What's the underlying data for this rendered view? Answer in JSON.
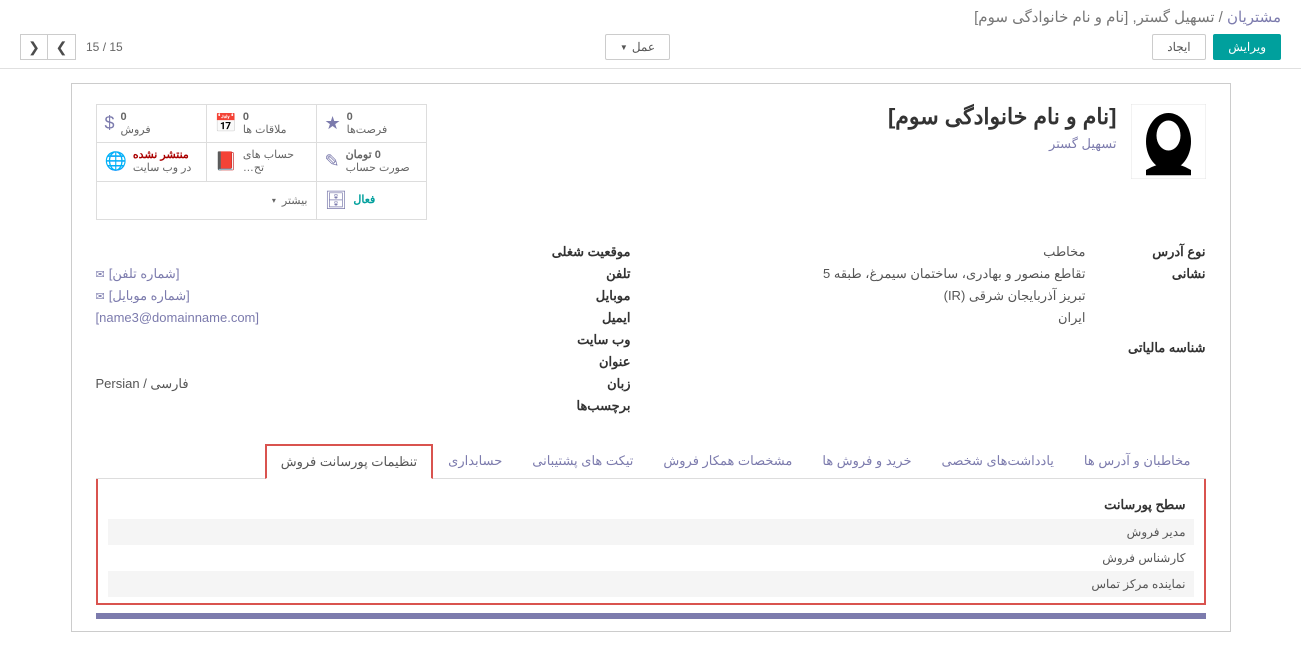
{
  "breadcrumb": {
    "root": "مشتریان",
    "sep": "/",
    "current": "تسهیل گستر, [نام و نام خانوادگی سوم]"
  },
  "toolbar": {
    "edit": "ویرایش",
    "create": "ایجاد",
    "action": "عمل"
  },
  "pager": {
    "range": "15 / 15"
  },
  "header": {
    "name": "[نام و نام خانوادگی سوم]",
    "company": "تسهیل گستر"
  },
  "stats": {
    "opp_val": "0",
    "opp_label": "فرصت‌ها",
    "meet_val": "0",
    "meet_label": "ملاقات ها",
    "sale_val": "0",
    "sale_label": "فروش",
    "invoice_val": "0 تومان",
    "invoice_label": "صورت حساب",
    "analytic_label": "حساب های تح…",
    "pub_status": "منتشر نشده",
    "pub_label": "در وب سایت",
    "active": "فعال",
    "more": "بیشتر"
  },
  "fields": {
    "right": [
      {
        "label": "نوع آدرس",
        "value": "مخاطب"
      },
      {
        "label": "نشانی",
        "value": "تقاطع منصور و بهادری، ساختمان سیمرغ، طبقه 5"
      },
      {
        "label": "",
        "value": "تبریز  آذربایجان شرقی (IR)"
      },
      {
        "label": "",
        "value": "ایران"
      },
      {
        "label": "شناسه مالیاتی",
        "value": ""
      }
    ],
    "left_labels": {
      "job": "موقعیت شغلی",
      "phone": "تلفن",
      "mobile": "موبایل",
      "email": "ایمیل",
      "website": "وب سایت",
      "title": "عنوان",
      "lang": "زبان",
      "tags": "برچسب‌ها"
    },
    "left_values": {
      "phone": "[شماره تلفن]",
      "mobile": "[شماره موبایل]",
      "email": "[name3@domainname.com]",
      "lang": "Persian / فارسی"
    }
  },
  "tabs": [
    "مخاطبان و آدرس ها",
    "یادداشت‌های شخصی",
    "خرید و فروش ها",
    "مشخصات همکار فروش",
    "تیکت های پشتیبانی",
    "حسابداری",
    "تنظیمات پورسانت فروش"
  ],
  "levels": {
    "header": "سطح پورسانت",
    "rows": [
      "مدیر فروش",
      "کارشناس فروش",
      "نماینده مرکز تماس"
    ]
  }
}
